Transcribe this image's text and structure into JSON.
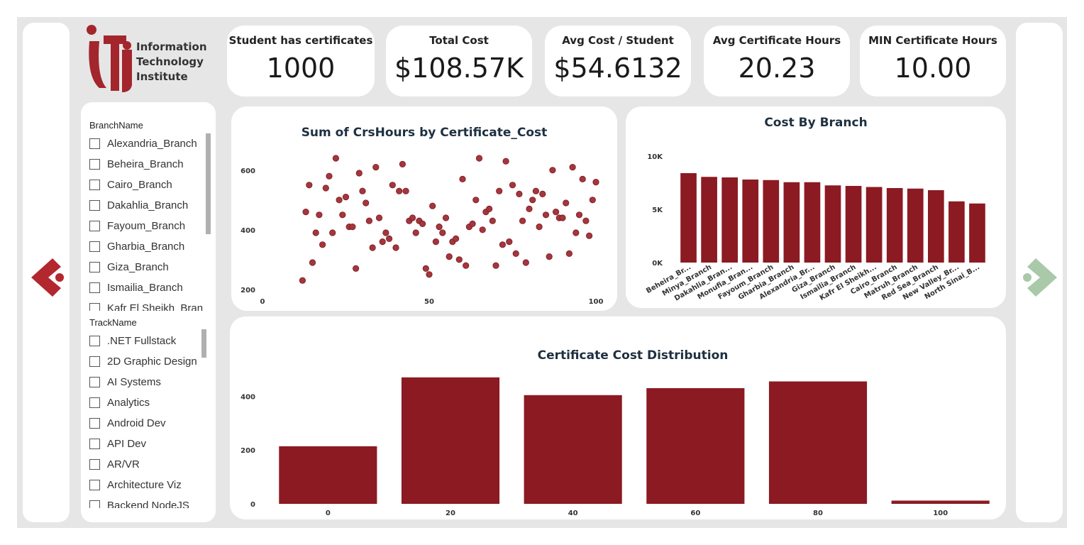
{
  "logo": {
    "lines": [
      "Information",
      "Technology",
      "Institute"
    ],
    "brand_color": "#a3262d"
  },
  "kpis": [
    {
      "title": "Student has certificates",
      "value": "1000"
    },
    {
      "title": "Total Cost",
      "value": "$108.57K"
    },
    {
      "title": "Avg Cost / Student",
      "value": "$54.6132"
    },
    {
      "title": "Avg Certificate Hours",
      "value": "20.23"
    },
    {
      "title": "MIN Certificate Hours",
      "value": "10.00"
    }
  ],
  "slicers": {
    "branch": {
      "title": "BranchName",
      "items": [
        "Alexandria_Branch",
        "Beheira_Branch",
        "Cairo_Branch",
        "Dakahlia_Branch",
        "Fayoum_Branch",
        "Gharbia_Branch",
        "Giza_Branch",
        "Ismailia_Branch",
        "Kafr El Sheikh_Bran"
      ]
    },
    "track": {
      "title": "TrackName",
      "items": [
        ".NET Fullstack",
        "2D Graphic Design",
        "AI Systems",
        "Analytics",
        "Android Dev",
        "API Dev",
        "AR/VR",
        "Architecture Viz",
        "Backend NodeJS"
      ]
    }
  },
  "navigation": {
    "back_icon": "chevron-left-icon",
    "forward_icon": "chevron-right-icon",
    "back_color": "#b3272f",
    "forward_color": "#a9c9a9"
  },
  "chart_data": [
    {
      "type": "scatter",
      "title": "Sum of CrsHours by Certificate_Cost",
      "xlabel": "",
      "ylabel": "",
      "xlim": [
        0,
        100
      ],
      "ylim": [
        190,
        690
      ],
      "xticks": [
        0,
        50,
        100
      ],
      "yticks": [
        200,
        400,
        600
      ],
      "color": "#a4363d",
      "points": [
        [
          12,
          230
        ],
        [
          13,
          460
        ],
        [
          14,
          550
        ],
        [
          15,
          290
        ],
        [
          16,
          390
        ],
        [
          17,
          450
        ],
        [
          18,
          350
        ],
        [
          19,
          540
        ],
        [
          20,
          580
        ],
        [
          21,
          390
        ],
        [
          22,
          640
        ],
        [
          23,
          500
        ],
        [
          24,
          450
        ],
        [
          25,
          510
        ],
        [
          26,
          410
        ],
        [
          27,
          410
        ],
        [
          28,
          270
        ],
        [
          29,
          590
        ],
        [
          30,
          530
        ],
        [
          31,
          490
        ],
        [
          32,
          430
        ],
        [
          33,
          340
        ],
        [
          34,
          610
        ],
        [
          35,
          440
        ],
        [
          36,
          360
        ],
        [
          37,
          390
        ],
        [
          38,
          370
        ],
        [
          39,
          550
        ],
        [
          40,
          340
        ],
        [
          41,
          530
        ],
        [
          42,
          620
        ],
        [
          43,
          530
        ],
        [
          44,
          430
        ],
        [
          45,
          440
        ],
        [
          46,
          390
        ],
        [
          47,
          430
        ],
        [
          48,
          420
        ],
        [
          49,
          270
        ],
        [
          50,
          250
        ],
        [
          51,
          480
        ],
        [
          52,
          360
        ],
        [
          53,
          410
        ],
        [
          54,
          390
        ],
        [
          55,
          440
        ],
        [
          56,
          310
        ],
        [
          57,
          360
        ],
        [
          58,
          370
        ],
        [
          59,
          300
        ],
        [
          60,
          570
        ],
        [
          61,
          280
        ],
        [
          62,
          410
        ],
        [
          63,
          420
        ],
        [
          64,
          500
        ],
        [
          65,
          640
        ],
        [
          66,
          400
        ],
        [
          67,
          460
        ],
        [
          68,
          470
        ],
        [
          69,
          430
        ],
        [
          70,
          280
        ],
        [
          71,
          530
        ],
        [
          72,
          350
        ],
        [
          73,
          630
        ],
        [
          74,
          360
        ],
        [
          75,
          550
        ],
        [
          76,
          320
        ],
        [
          77,
          520
        ],
        [
          78,
          430
        ],
        [
          79,
          290
        ],
        [
          80,
          470
        ],
        [
          81,
          500
        ],
        [
          82,
          530
        ],
        [
          83,
          410
        ],
        [
          84,
          520
        ],
        [
          85,
          450
        ],
        [
          86,
          310
        ],
        [
          87,
          600
        ],
        [
          88,
          460
        ],
        [
          89,
          440
        ],
        [
          90,
          440
        ],
        [
          91,
          490
        ],
        [
          92,
          320
        ],
        [
          93,
          610
        ],
        [
          94,
          390
        ],
        [
          95,
          450
        ],
        [
          96,
          570
        ],
        [
          97,
          430
        ],
        [
          98,
          380
        ],
        [
          99,
          500
        ],
        [
          100,
          560
        ],
        [
          101,
          270
        ]
      ]
    },
    {
      "type": "bar",
      "title": "Cost By Branch",
      "xlabel": "",
      "ylabel": "",
      "ylim": [
        0,
        10000
      ],
      "yticks": [
        0,
        5000,
        10000
      ],
      "ytick_labels": [
        "0K",
        "5K",
        "10K"
      ],
      "color": "#8b1a22",
      "categories": [
        "Beheira_Br...",
        "Minya_Branch",
        "Dakahlia_Bran...",
        "Monufia_Bran...",
        "Fayoum_Branch",
        "Gharbia_Branch",
        "Alexandria_Br...",
        "Giza_Branch",
        "Ismailia_Branch",
        "Kafr El Sheikh...",
        "Cairo_Branch",
        "Matruh_Branch",
        "Red Sea_Branch",
        "New Valley_Br...",
        "North Sinai_B..."
      ],
      "values": [
        8400,
        8050,
        8000,
        7800,
        7750,
        7550,
        7550,
        7250,
        7200,
        7100,
        7000,
        6950,
        6800,
        5750,
        5550
      ]
    },
    {
      "type": "bar",
      "title": "Certificate Cost Distribution",
      "xlabel": "",
      "ylabel": "",
      "ylim": [
        0,
        480
      ],
      "yticks": [
        0,
        200,
        400
      ],
      "color": "#8b1a22",
      "categories": [
        "0",
        "20",
        "40",
        "60",
        "80",
        "100"
      ],
      "values": [
        214,
        470,
        404,
        430,
        455,
        12
      ]
    }
  ]
}
